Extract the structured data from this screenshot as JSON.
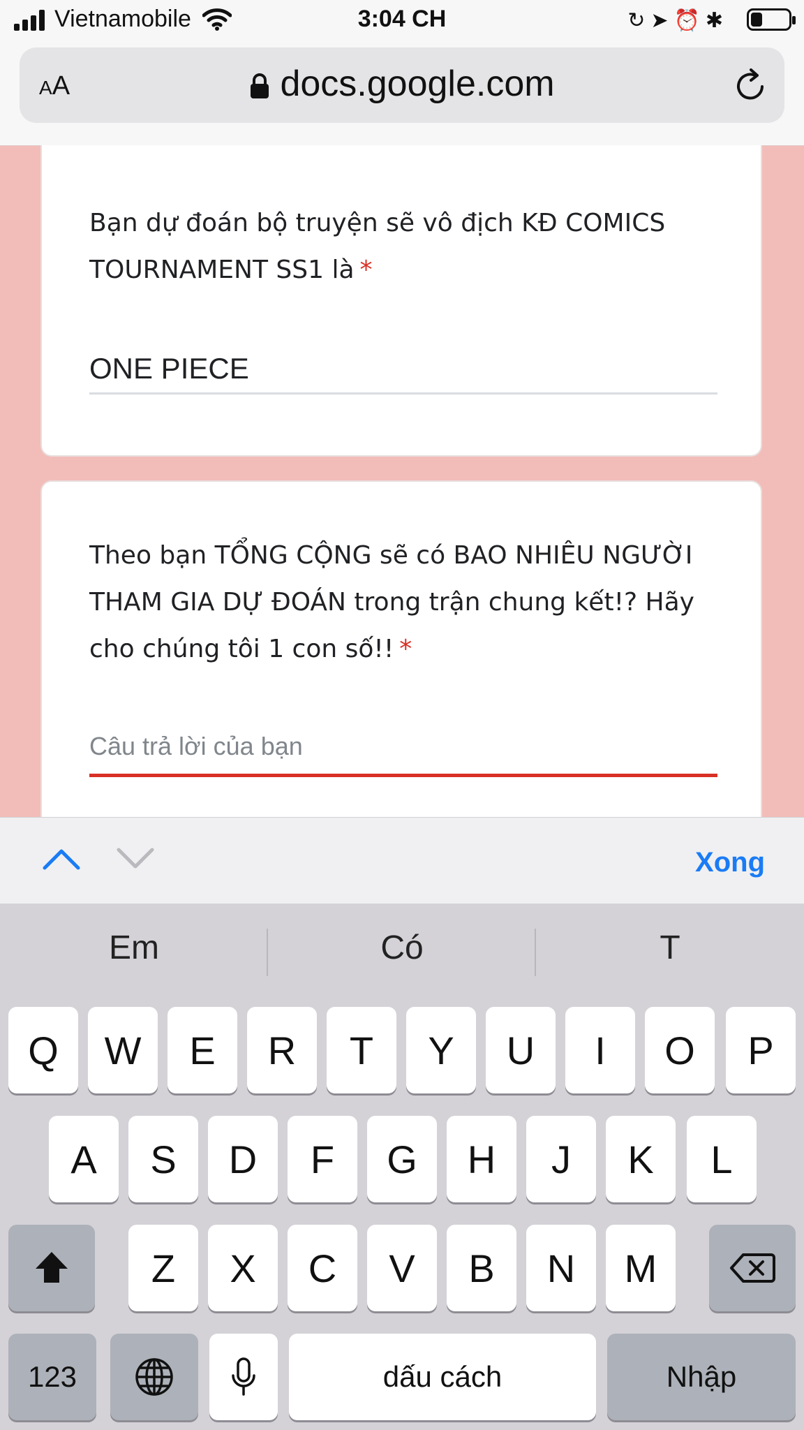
{
  "status_bar": {
    "carrier": "Vietnamobile",
    "time": "3:04 CH",
    "battery_level": 0.3
  },
  "browser": {
    "text_size_label": "AA",
    "domain": "docs.google.com"
  },
  "form": {
    "questions": [
      {
        "text": "Bạn dự đoán bộ truyện sẽ vô địch KĐ COMICS TOURNAMENT SS1 là",
        "required_mark": "*",
        "answer": "ONE PIECE"
      },
      {
        "text": "Theo bạn TỔNG CỘNG sẽ có BAO NHIÊU NGƯỜI THAM GIA DỰ ĐOÁN trong trận chung kết!? Hãy cho chúng tôi 1 con số!!",
        "required_mark": "*",
        "placeholder": "Câu trả lời của bạn"
      }
    ]
  },
  "accessory": {
    "done_label": "Xong"
  },
  "keyboard": {
    "suggestions": [
      "Em",
      "Có",
      "T"
    ],
    "row1": [
      "Q",
      "W",
      "E",
      "R",
      "T",
      "Y",
      "U",
      "I",
      "O",
      "P"
    ],
    "row2": [
      "A",
      "S",
      "D",
      "F",
      "G",
      "H",
      "J",
      "K",
      "L"
    ],
    "row3": [
      "Z",
      "X",
      "C",
      "V",
      "B",
      "N",
      "M"
    ],
    "numbers_label": "123",
    "space_label": "dấu cách",
    "return_label": "Nhập"
  },
  "colors": {
    "page_background": "#f2bdb9",
    "required_red": "#d93025",
    "link_blue": "#1a7cf5"
  }
}
